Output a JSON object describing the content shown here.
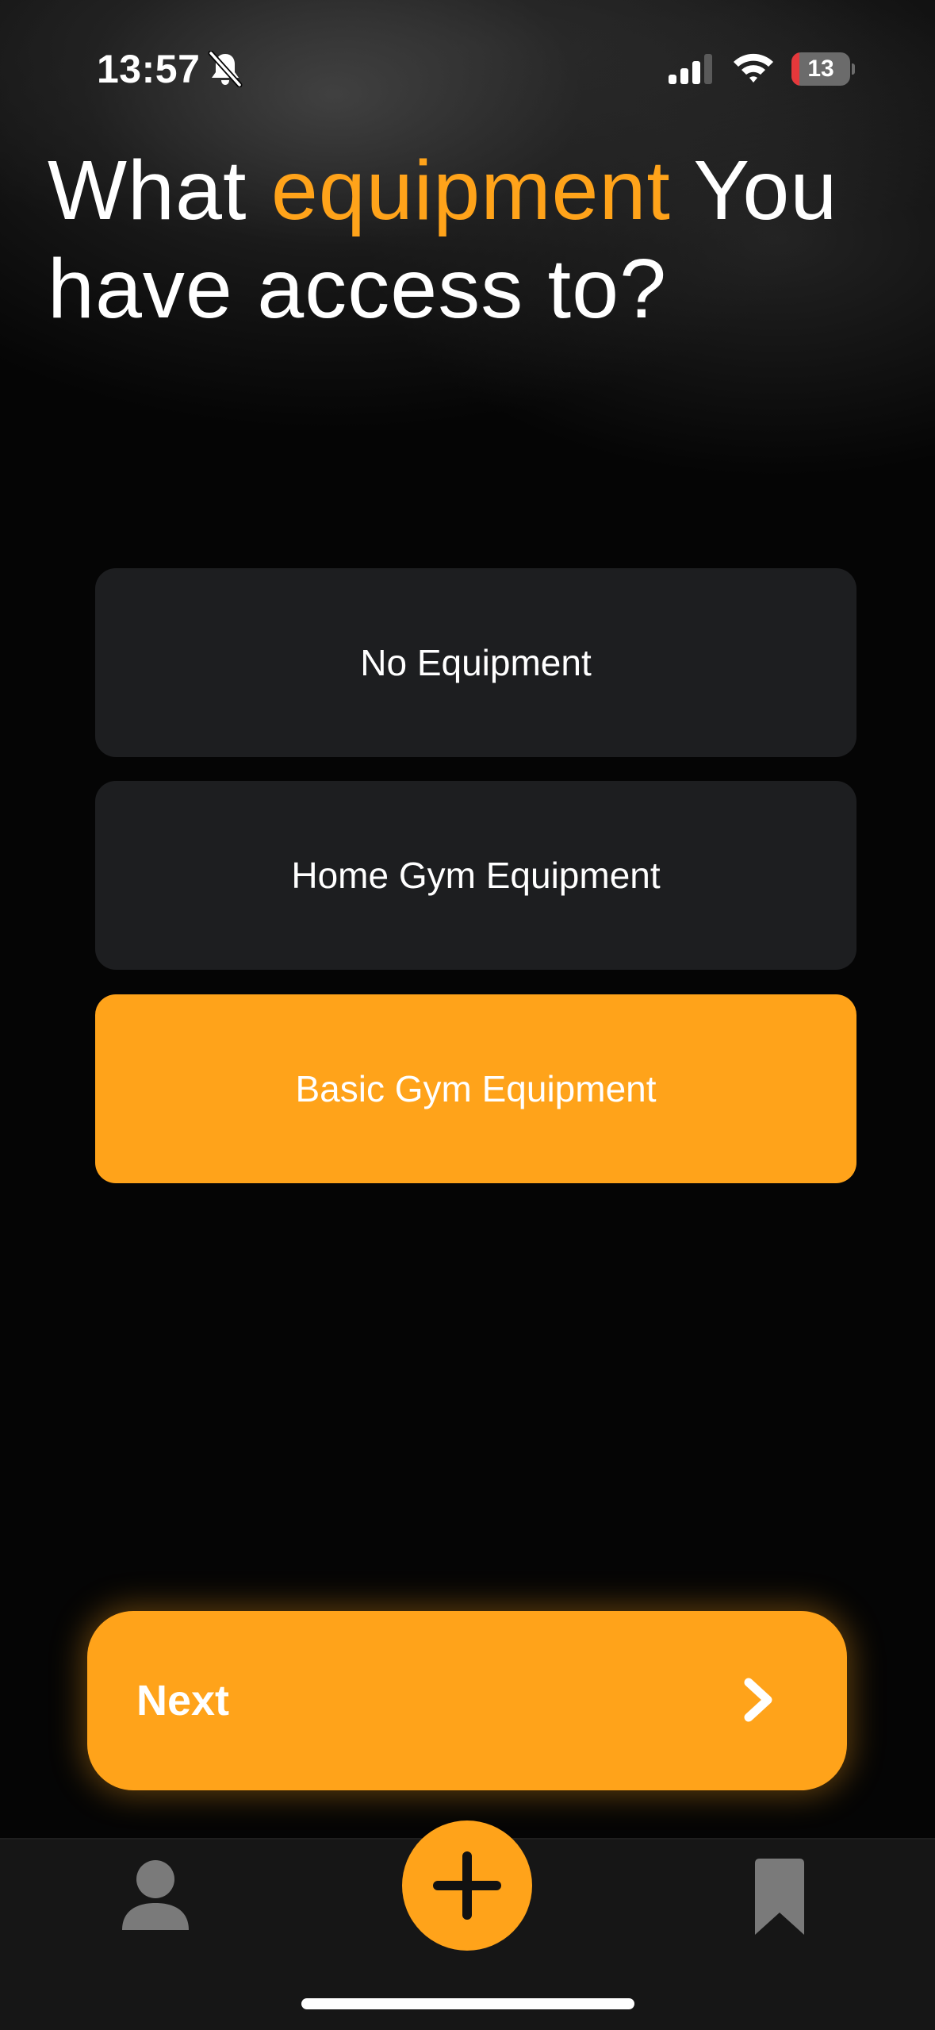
{
  "status_bar": {
    "time": "13:57",
    "battery_level": "13",
    "icons": [
      "bell-off-icon",
      "cellular-signal-icon",
      "wifi-icon",
      "battery-icon"
    ]
  },
  "title": {
    "prefix": "What ",
    "highlight": "equipment",
    "suffix": " You have access to?"
  },
  "options": [
    {
      "label": "No Equipment",
      "selected": false
    },
    {
      "label": "Home Gym Equipment",
      "selected": false
    },
    {
      "label": "Basic Gym Equipment",
      "selected": true
    }
  ],
  "next_button": {
    "label": "Next",
    "icon": "chevron-right-icon"
  },
  "tab_bar": {
    "items": [
      {
        "icon": "person-icon"
      },
      {
        "icon": "plus-icon"
      },
      {
        "icon": "bookmark-icon"
      }
    ]
  },
  "colors": {
    "accent": "#ffa31a",
    "background": "#050505",
    "option_background": "#1d1e20",
    "tab_bar_background": "#161616",
    "icon_gray": "#7a7a7a",
    "battery_low": "#e5383b"
  }
}
